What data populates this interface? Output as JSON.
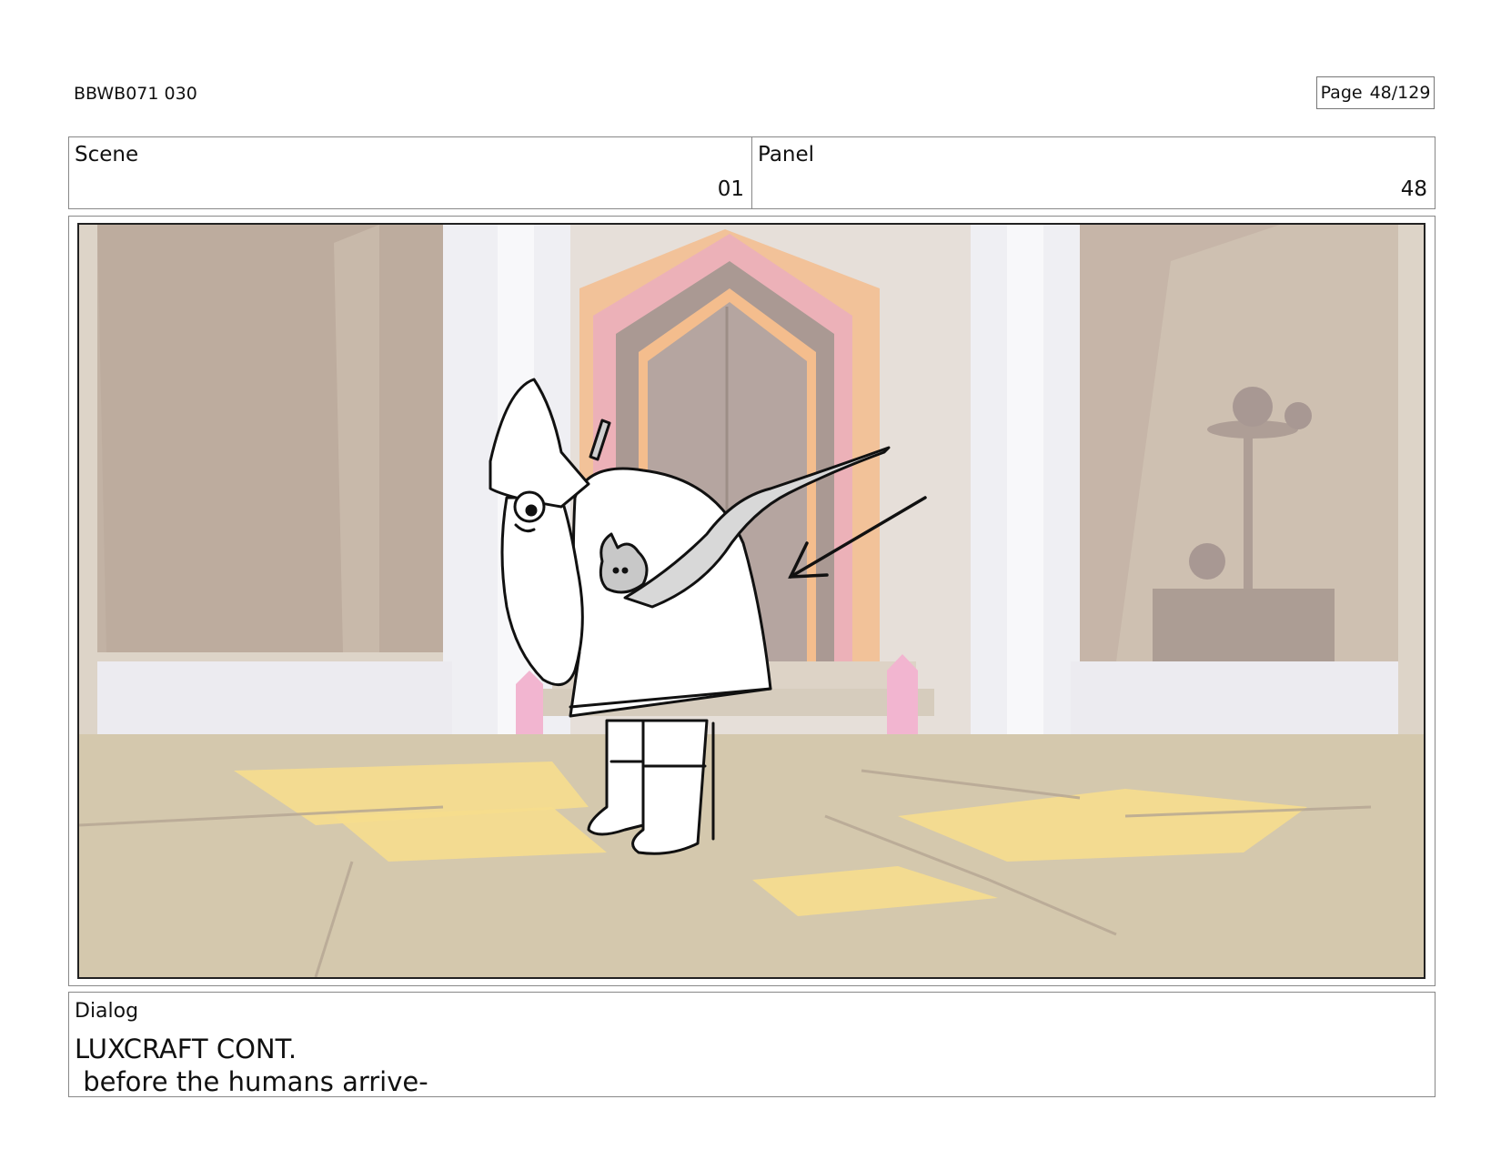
{
  "header": {
    "id": "BBWB071 030",
    "page_label": "Page",
    "page_number": "48/129"
  },
  "scene": {
    "label": "Scene",
    "value": "01"
  },
  "panel": {
    "label": "Panel",
    "value": "48"
  },
  "dialog": {
    "label": "Dialog",
    "speaker": "LUXCRAFT CONT.",
    "line": " before the humans arrive-"
  },
  "colors": {
    "wall": "#c9b8a6",
    "floor": "#cbbb9e",
    "pillar": "#ececef",
    "door_orange": "#f2b27a",
    "door_pink": "#e8a2b0",
    "door_dark": "#8c7b73",
    "floor_light": "#f5d77a",
    "crystal": "#f0a8c8"
  },
  "icons": [
    "storyboard-panel-illustration",
    "direction-arrow-icon"
  ]
}
